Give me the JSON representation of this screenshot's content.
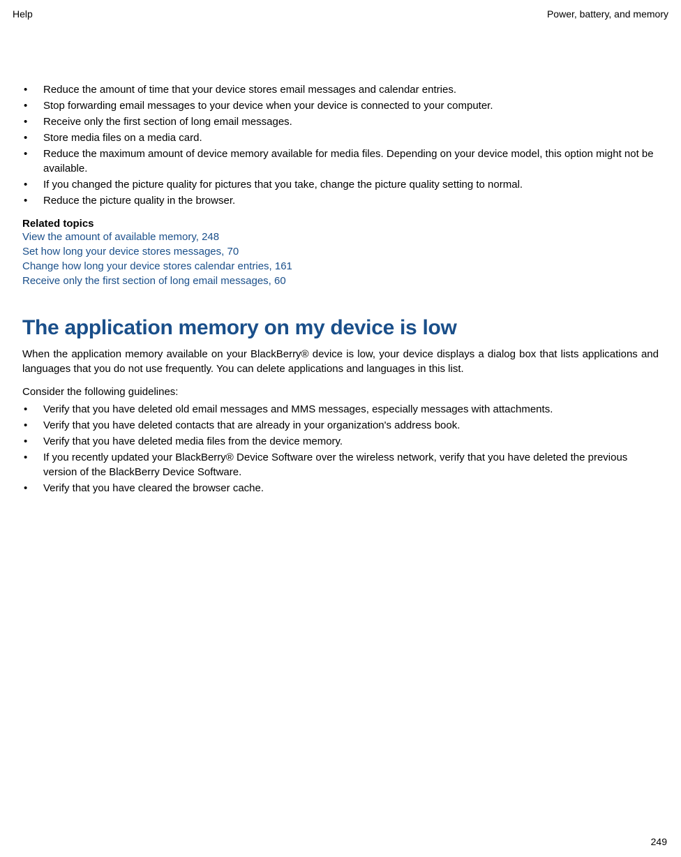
{
  "header": {
    "left": "Help",
    "right": "Power, battery, and memory"
  },
  "bullets1": [
    "Reduce the amount of time that your device stores email messages and calendar entries.",
    "Stop forwarding email messages to your device when your device is connected to your computer.",
    "Receive only the first section of long email messages.",
    "Store media files on a media card.",
    "Reduce the maximum amount of device memory available for media files. Depending on your device model, this option might not be available.",
    "If you changed the picture quality for pictures that you take, change the picture quality setting to normal.",
    "Reduce the picture quality in the browser."
  ],
  "related": {
    "heading": "Related topics",
    "links": [
      "View the amount of available memory, 248",
      "Set how long your device stores messages, 70",
      "Change how long your device stores calendar entries, 161",
      "Receive only the first section of long email messages, 60"
    ]
  },
  "section": {
    "title": "The application memory on my device is low",
    "para": "When the application memory available on your BlackBerry® device is low, your device displays a dialog box that lists applications and languages that you do not use frequently. You can delete applications and languages in this list.",
    "sub": "Consider the following guidelines:",
    "bullets": [
      "Verify that you have deleted old email messages and MMS messages, especially messages with attachments.",
      "Verify that you have deleted contacts that are already in your organization's address book.",
      "Verify that you have deleted media files from the device memory.",
      "If you recently updated your BlackBerry® Device Software over the wireless network, verify that you have deleted the previous version of the BlackBerry Device Software.",
      "Verify that you have cleared the browser cache."
    ]
  },
  "page_number": "249"
}
